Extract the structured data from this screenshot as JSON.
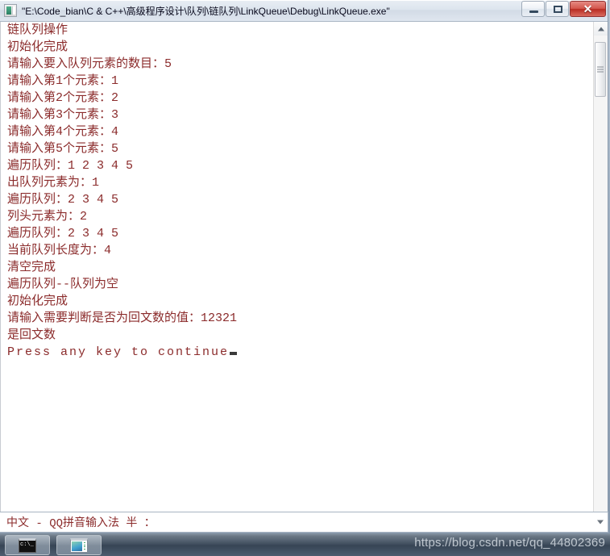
{
  "window": {
    "title": "\"E:\\Code_bian\\C & C++\\高级程序设计\\队列\\链队列\\LinkQueue\\Debug\\LinkQueue.exe\"",
    "icon": "console-app-icon",
    "controls": {
      "minimize_label": "–",
      "maximize_label": "□",
      "close_label": "✕"
    }
  },
  "console": {
    "text_color": "#8b2b2b",
    "background_color": "#ffffff",
    "lines": [
      "链队列操作",
      "初始化完成",
      "请输入要入队列元素的数目：5",
      "请输入第1个元素：1",
      "请输入第2个元素：2",
      "请输入第3个元素：3",
      "请输入第4个元素：4",
      "请输入第5个元素：5",
      "遍历队列：1 2 3 4 5",
      "出队列元素为：1",
      "遍历队列：2 3 4 5",
      "列头元素为：2",
      "遍历队列：2 3 4 5",
      "当前队列长度为：4",
      "清空完成",
      "遍历队列--队列为空",
      "初始化完成",
      "请输入需要判断是否为回文数的值：12321",
      "是回文数"
    ],
    "prompt_line": "Press any key to continue",
    "cursor": "block-cursor"
  },
  "scrollbar": {
    "up_arrow": "scroll-up-icon",
    "down_arrow": "scroll-down-icon",
    "thumb": "scroll-thumb"
  },
  "ime_bar": {
    "text": "中文 - QQ拼音输入法 半 ："
  },
  "taskbar": {
    "items": [
      {
        "name": "console-window-task",
        "icon": "cmd-icon"
      },
      {
        "name": "editor-window-task",
        "icon": "editor-icon"
      }
    ],
    "watermark": "https://blog.csdn.net/qq_44802369"
  }
}
